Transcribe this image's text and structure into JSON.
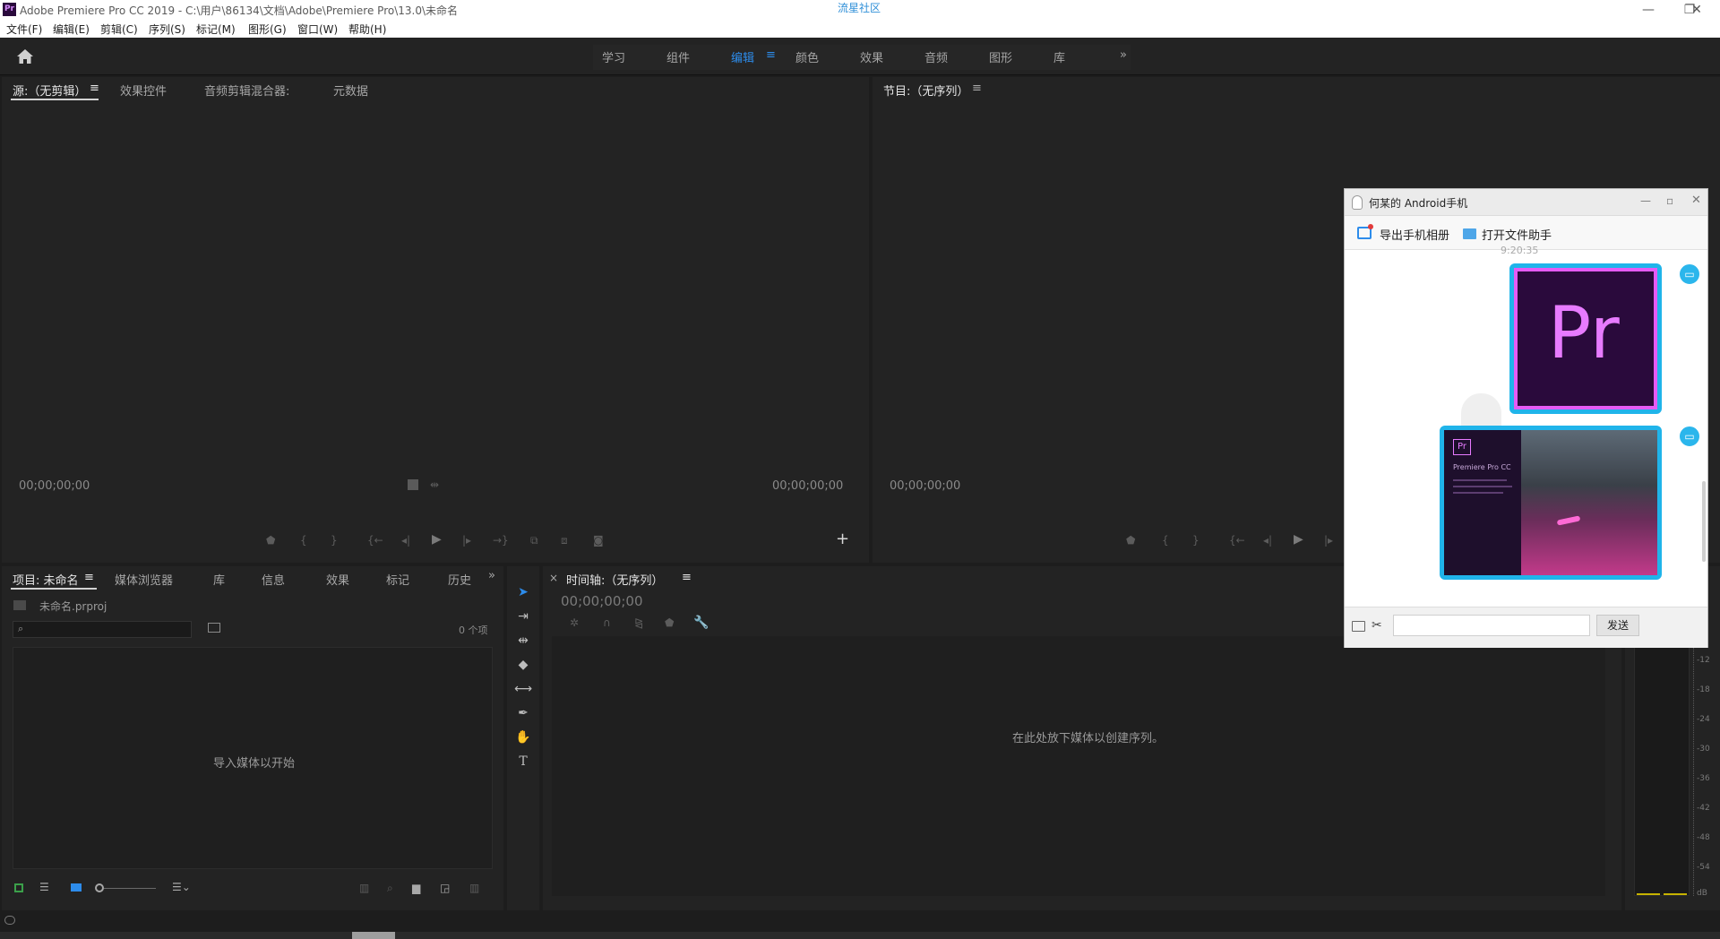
{
  "titlebar": {
    "app_badge": "Pr",
    "title": "Adobe Premiere Pro CC 2019 - C:\\用户\\86134\\文档\\Adobe\\Premiere Pro\\13.0\\未命名",
    "center_text": "流星社区",
    "minimize": "—",
    "restore": "❐",
    "close": "✕"
  },
  "menubar": {
    "items": [
      "文件(F)",
      "编辑(E)",
      "剪辑(C)",
      "序列(S)",
      "标记(M)",
      "图形(G)",
      "窗口(W)",
      "帮助(H)"
    ]
  },
  "workspaces": {
    "items": [
      "学习",
      "组件",
      "编辑",
      "颜色",
      "效果",
      "音频",
      "图形",
      "库"
    ],
    "active": "编辑",
    "menu_glyph": "≡",
    "overflow": "»"
  },
  "source_panel": {
    "tabs": [
      "源:（无剪辑）",
      "效果控件",
      "音频剪辑混合器:",
      "元数据"
    ],
    "tab_menu": "≡",
    "timecode_left": "00;00;00;00",
    "timecode_right": "00;00;00;00",
    "add_button": "+"
  },
  "program_panel": {
    "tab": "节目:（无序列）",
    "tab_menu": "≡",
    "timecode_left": "00;00;00;00"
  },
  "project_panel": {
    "tabs": [
      "项目: 未命名",
      "媒体浏览器",
      "库",
      "信息",
      "效果",
      "标记",
      "历史"
    ],
    "tab_menu": "≡",
    "overflow": "»",
    "file_name": "未命名.prproj",
    "search_placeholder": "",
    "item_count": "0 个项",
    "empty_text": "导入媒体以开始"
  },
  "timeline_panel": {
    "close": "×",
    "tab": "时间轴:（无序列）",
    "tab_menu": "≡",
    "timecode": "00;00;00;00",
    "empty_text": "在此处放下媒体以创建序列。"
  },
  "audio_meter": {
    "ticks": [
      "-12",
      "-18",
      "-24",
      "-30",
      "-36",
      "-42",
      "-48",
      "-54",
      "dB"
    ]
  },
  "qq_window": {
    "title": "何某的 Android手机",
    "toolbar": {
      "export_album": "导出手机相册",
      "open_file_helper": "打开文件助手"
    },
    "timestamp": "9:20:35",
    "image1_logo": "Pr",
    "image2_badge": "Pr",
    "image2_title": "Premiere Pro CC",
    "send_button": "发送",
    "input_value": ""
  },
  "colors": {
    "accent": "#2d8ceb",
    "qq_bubble": "#20b4ea",
    "pr_purple": "#2a0a3c",
    "pr_text": "#e77bff"
  }
}
